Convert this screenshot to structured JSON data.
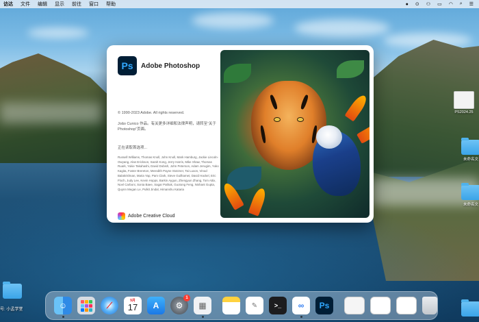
{
  "menubar": {
    "app_name": "访达",
    "items": [
      "文件",
      "编辑",
      "显示",
      "前往",
      "窗口",
      "帮助"
    ],
    "status_icons": [
      "record-icon",
      "screen-mirroring-icon",
      "people-icon",
      "battery-icon",
      "wifi-icon",
      "search-icon",
      "control-center-icon"
    ]
  },
  "splash": {
    "logo_text": "Ps",
    "title": "Adobe Photoshop",
    "copyright": "© 1990-2023 Adobe. All rights reserved.",
    "author": "João Cunico 作品。有关更多详细和法律声明，请转至“关于 Photoshop”页面。",
    "loading": "正在读取首选项...",
    "credits": "Russell Williams, Thomas Knoll, John Knoll, Mark Hamburg, Jackie Lincoln-Owyang, Alan Erickson, Sarah Kong, Jerry Harris, Mike Shaw, Thomas Ruark, Yukie Takahashi, David Dobish, John Peterson, Adam Jerugim, Yuko Kagita, Foster Brereton, Meredith Payne Stotzner, Tai Luxon, Vinod Balakrishnan, Maria Yap, Pam Clark, Steve Guilhamet, David Hackel, Eric Floch, Judy Lee, Kevin Hopps, Barkin Aygun, Zhengyun Zhang, Tom Attix, Noel Carboni, Sonia Baee, Sagar Pathak, Guotong Feng, Nishant Gupta, Quynn Megan Le, Pulkit Jindal, Himanshu Kataria",
    "creative_cloud": "Adobe Creative Cloud"
  },
  "desktop": {
    "items": [
      {
        "label": "PS2024.25",
        "kind": "file"
      },
      {
        "label": "未命名文",
        "kind": "folder"
      },
      {
        "label": "未命名文",
        "kind": "folder"
      }
    ],
    "watermark": "号: 小孟学堂"
  },
  "dock": {
    "items": [
      {
        "name": "finder"
      },
      {
        "name": "launchpad"
      },
      {
        "name": "safari"
      },
      {
        "name": "calendar",
        "month": "9月",
        "day": "17"
      },
      {
        "name": "app-store"
      },
      {
        "name": "system-preferences",
        "badge": "1"
      },
      {
        "name": "preview"
      },
      {
        "name": "notes"
      },
      {
        "name": "textedit"
      },
      {
        "name": "terminal"
      },
      {
        "name": "baidu-netdisk"
      },
      {
        "name": "photoshop",
        "label": "Ps"
      }
    ],
    "trash": "trash-icon"
  },
  "colors": {
    "ps_dark": "#001e36",
    "ps_blue": "#31a8ff",
    "badge_red": "#ff3b30"
  }
}
